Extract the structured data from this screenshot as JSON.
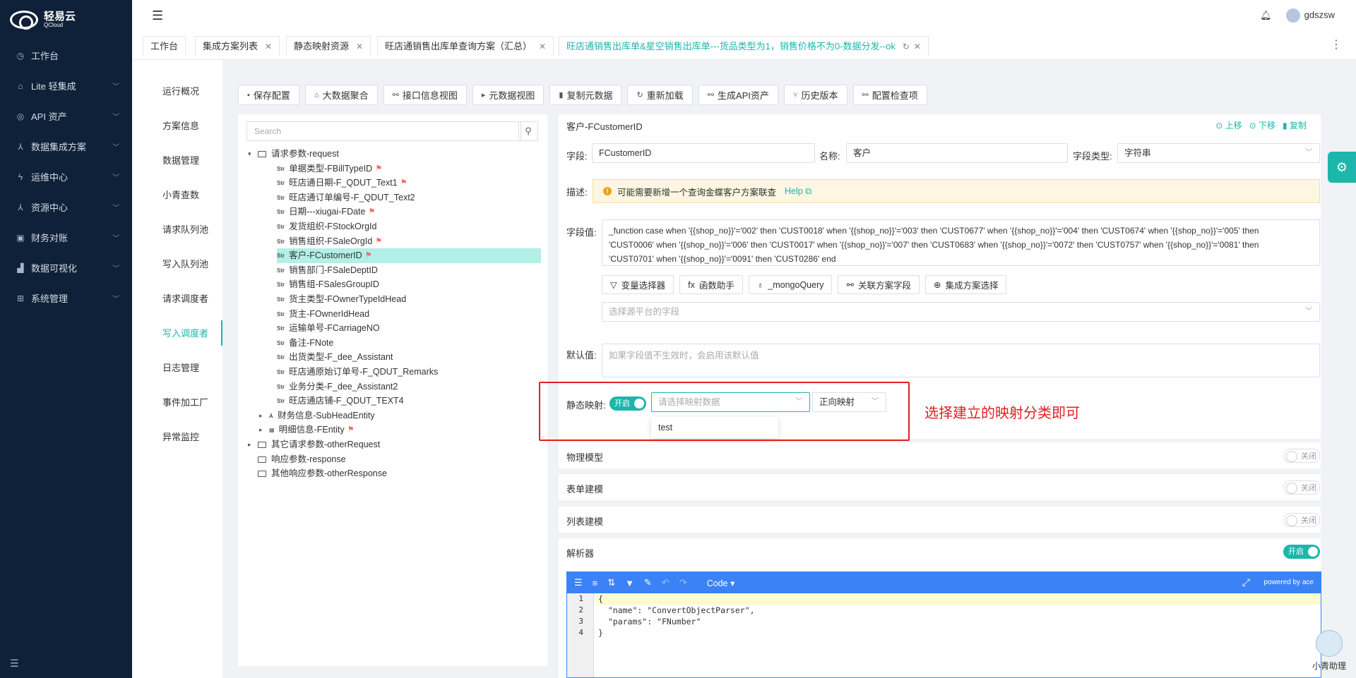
{
  "app": {
    "logo_text": "轻易云",
    "logo_sub": "QCloud"
  },
  "sidebar": {
    "items": [
      {
        "label": "工作台",
        "icon": "clock-icon",
        "glyph": "◷",
        "chevron": false
      },
      {
        "label": "Lite 轻集成",
        "icon": "lite-icon",
        "glyph": "⌂",
        "chevron": true
      },
      {
        "label": "API 资产",
        "icon": "api-icon",
        "glyph": "◎",
        "chevron": true
      },
      {
        "label": "数据集成方案",
        "icon": "integration-icon",
        "glyph": "⅄",
        "chevron": true
      },
      {
        "label": "运维中心",
        "icon": "ops-icon",
        "glyph": "ϟ",
        "chevron": true
      },
      {
        "label": "资源中心",
        "icon": "resource-icon",
        "glyph": "⅄",
        "chevron": true
      },
      {
        "label": "财务对账",
        "icon": "finance-icon",
        "glyph": "▣",
        "chevron": true
      },
      {
        "label": "数据可视化",
        "icon": "chart-icon",
        "glyph": "▟",
        "chevron": true
      },
      {
        "label": "系统管理",
        "icon": "system-icon",
        "glyph": "⊞",
        "chevron": true
      }
    ]
  },
  "topbar": {
    "user": "gdszsw"
  },
  "tabs": [
    {
      "label": "工作台",
      "closable": false
    },
    {
      "label": "集成方案列表",
      "closable": true
    },
    {
      "label": "静态映射资源",
      "closable": true
    },
    {
      "label": "旺店通销售出库单查询方案（汇总）",
      "closable": true
    },
    {
      "label": "旺店通销售出库单&星空销售出库单---货品类型为1，销售价格不为0-数据分发--ok",
      "closable": true,
      "active": true
    }
  ],
  "subnav": [
    "运行概况",
    "方案信息",
    "数据管理",
    "小青查数",
    "请求队列池",
    "写入队列池",
    "请求调度者",
    "写入调度者",
    "日志管理",
    "事件加工厂",
    "异常监控"
  ],
  "subnav_active": "写入调度者",
  "toolbar": [
    {
      "label": "保存配置",
      "icon": "save-icon",
      "glyph": "▪"
    },
    {
      "label": "大数据聚合",
      "icon": "aggregate-icon",
      "glyph": "⌂"
    },
    {
      "label": "接口信息视图",
      "icon": "link-icon",
      "glyph": "⚯"
    },
    {
      "label": "元数据视图",
      "icon": "terminal-icon",
      "glyph": "▸"
    },
    {
      "label": "复制元数据",
      "icon": "copy-icon",
      "glyph": "▮"
    },
    {
      "label": "重新加载",
      "icon": "reload-icon",
      "glyph": "↻"
    },
    {
      "label": "生成API资产",
      "icon": "link-icon",
      "glyph": "⚯"
    },
    {
      "label": "历史版本",
      "icon": "branch-icon",
      "glyph": "⑂"
    },
    {
      "label": "配置检查项",
      "icon": "link-icon",
      "glyph": "⚯"
    }
  ],
  "tree": {
    "search_placeholder": "Search",
    "nodes": [
      {
        "label": "请求参数-request",
        "kind": "folder",
        "arrow": "▾",
        "depth": 0
      },
      {
        "label": "单据类型-FBillTypeID",
        "kind": "str",
        "flag": true,
        "depth": 2
      },
      {
        "label": "旺店通日期-F_QDUT_Text1",
        "kind": "str",
        "flag": true,
        "depth": 2
      },
      {
        "label": "旺店通订单编号-F_QDUT_Text2",
        "kind": "str",
        "flag": false,
        "depth": 2
      },
      {
        "label": "日期---xiugai-FDate",
        "kind": "str",
        "flag": true,
        "depth": 2
      },
      {
        "label": "发货组织-FStockOrgId",
        "kind": "str",
        "flag": false,
        "depth": 2
      },
      {
        "label": "销售组织-FSaleOrgId",
        "kind": "str",
        "flag": true,
        "depth": 2
      },
      {
        "label": "客户-FCustomerID",
        "kind": "str",
        "flag": true,
        "depth": 2,
        "selected": true
      },
      {
        "label": "销售部门-FSaleDeptID",
        "kind": "str",
        "flag": false,
        "depth": 2
      },
      {
        "label": "销售组-FSalesGroupID",
        "kind": "str",
        "flag": false,
        "depth": 2
      },
      {
        "label": "货主类型-FOwnerTypeIdHead",
        "kind": "str",
        "flag": false,
        "depth": 2
      },
      {
        "label": "货主-FOwnerIdHead",
        "kind": "str",
        "flag": false,
        "depth": 2
      },
      {
        "label": "运输单号-FCarriageNO",
        "kind": "str",
        "flag": false,
        "depth": 2
      },
      {
        "label": "备注-FNote",
        "kind": "str",
        "flag": false,
        "depth": 2
      },
      {
        "label": "出货类型-F_dee_Assistant",
        "kind": "str",
        "flag": false,
        "depth": 2
      },
      {
        "label": "旺店通原始订单号-F_QDUT_Remarks",
        "kind": "str",
        "flag": false,
        "depth": 2
      },
      {
        "label": "业务分类-F_dee_Assistant2",
        "kind": "str",
        "flag": false,
        "depth": 2
      },
      {
        "label": "旺店通店铺-F_QDUT_TEXT4",
        "kind": "str",
        "flag": false,
        "depth": 2
      },
      {
        "label": "财务信息-SubHeadEntity",
        "kind": "object",
        "arrow": "▸",
        "flag": false,
        "depth": 1
      },
      {
        "label": "明细信息-FEntity",
        "kind": "table",
        "arrow": "▸",
        "flag": true,
        "depth": 1
      },
      {
        "label": "其它请求参数-otherRequest",
        "kind": "folder",
        "arrow": "▸",
        "depth": 0
      },
      {
        "label": "响应参数-response",
        "kind": "folder",
        "depth": 0
      },
      {
        "label": "其他响应参数-otherResponse",
        "kind": "folder",
        "depth": 0
      }
    ]
  },
  "detail": {
    "title": "客户-FCustomerID",
    "actions": {
      "up": "上移",
      "down": "下移",
      "copy": "复制"
    },
    "field_label": "字段:",
    "field_value": "FCustomerID",
    "name_label": "名称:",
    "name_value": "客户",
    "type_label": "字段类型:",
    "type_value": "字符串",
    "desc_label": "描述:",
    "desc_text": "可能需要新增一个查询金蝶客户方案联查",
    "desc_help": "Help",
    "value_label": "字段值:",
    "value_line1": "_function case when '{{shop_no}}'='002' then 'CUST0018' when '{{shop_no}}'='003' then 'CUST0677'  when '{{shop_no}}'='004' then 'CUST0674' when '{{shop_no}}'='005' then",
    "value_line2": "'CUST0006' when '{{shop_no}}'='006' then 'CUST0017' when '{{shop_no}}'='007' then 'CUST0683' when '{{shop_no}}'='0072' then 'CUST0757' when '{{shop_no}}'='0081' then",
    "value_line3": "'CUST0701' when '{{shop_no}}'='0091' then 'CUST0286'  end",
    "helpers": [
      {
        "label": "变量选择器",
        "icon": "filter-icon",
        "glyph": "▽"
      },
      {
        "label": "函数助手",
        "icon": "function-icon",
        "glyph": "fx"
      },
      {
        "label": "_mongoQuery",
        "icon": "bulb-icon",
        "glyph": "♁"
      },
      {
        "label": "关联方案字段",
        "icon": "link-icon",
        "glyph": "⚯"
      },
      {
        "label": "集成方案选择",
        "icon": "cluster-icon",
        "glyph": "⊕"
      }
    ],
    "source_placeholder": "选择源平台的字段",
    "default_label": "默认值:",
    "default_placeholder": "如果字段值不生效时，会启用该默认值",
    "static_map_label": "静态映射:",
    "static_map_switch": "开启",
    "static_map_placeholder": "请选择映射数据",
    "static_map_direction": "正向映射",
    "static_map_option": "test"
  },
  "annotation": "选择建立的映射分类即可",
  "sections": [
    {
      "label": "物理模型",
      "switch": "关闭",
      "on": false
    },
    {
      "label": "表单建模",
      "switch": "关闭",
      "on": false
    },
    {
      "label": "列表建模",
      "switch": "关闭",
      "on": false
    },
    {
      "label": "解析器",
      "switch": "开启",
      "on": true
    }
  ],
  "editor": {
    "mode": "Code",
    "powered": "powered by ace",
    "lines": [
      "{",
      "  \"name\": \"ConvertObjectParser\",",
      "  \"params\": \"FNumber\"",
      "}"
    ],
    "line_numbers": [
      "1",
      "2",
      "3",
      "4"
    ]
  },
  "assistant_label": "小青助理",
  "colors": {
    "accent": "#1cb6aa",
    "sidebar_bg": "#0f2138",
    "annotation": "#e02020",
    "editor_bar": "#3b82f6"
  }
}
